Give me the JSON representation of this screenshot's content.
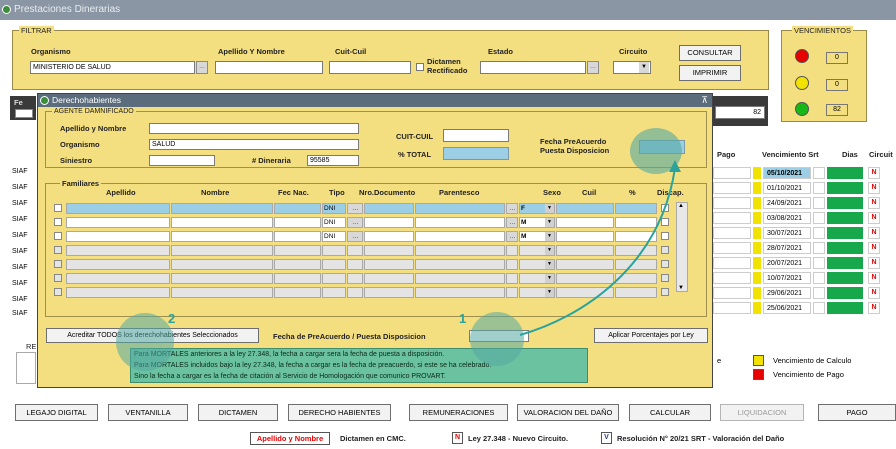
{
  "window": {
    "title": "Prestaciones Dinerarias"
  },
  "filtrar": {
    "group_label": "FILTRAR",
    "organismo_label": "Organismo",
    "organismo_value": "MINISTERIO DE SALUD",
    "apellido_label": "Apellido Y Nombre",
    "cuit_label": "Cuit-Cuil",
    "dictamen_label_1": "Dictamen",
    "dictamen_label_2": "Rectificado",
    "estado_label": "Estado",
    "circuito_label": "Circuito",
    "consultar_button": "CONSULTAR",
    "imprimir_button": "IMPRIMIR"
  },
  "vencimientos": {
    "title": "VENCIMIENTOS",
    "items": [
      {
        "color": "#e60000",
        "count": "0"
      },
      {
        "color": "#f2e200",
        "count": "0"
      },
      {
        "color": "#16b816",
        "count": "82"
      }
    ]
  },
  "background": {
    "total_count": "82",
    "fe_label": "Fe",
    "row_prefix": "SIAF",
    "re_label": "RE",
    "legend_e_fragment": "e",
    "columns": {
      "pago": "Pago",
      "venc_srt": "Vencimiento Srt",
      "dias": "Dias",
      "circuito": "Circuit"
    },
    "rows": [
      {
        "date": "05/10/2021",
        "flag": "N",
        "selected": true
      },
      {
        "date": "01/10/2021",
        "flag": "N",
        "selected": false
      },
      {
        "date": "24/09/2021",
        "flag": "N",
        "selected": false
      },
      {
        "date": "03/08/2021",
        "flag": "N",
        "selected": false
      },
      {
        "date": "30/07/2021",
        "flag": "N",
        "selected": false
      },
      {
        "date": "28/07/2021",
        "flag": "N",
        "selected": false
      },
      {
        "date": "20/07/2021",
        "flag": "N",
        "selected": false
      },
      {
        "date": "10/07/2021",
        "flag": "N",
        "selected": false
      },
      {
        "date": "29/06/2021",
        "flag": "N",
        "selected": false
      },
      {
        "date": "25/06/2021",
        "flag": "N",
        "selected": false
      }
    ],
    "legend": [
      {
        "color": "#f2e200",
        "label": "Vencimiento de Calculo"
      },
      {
        "color": "#e60000",
        "label": "Vencimiento de Pago"
      }
    ]
  },
  "dialog": {
    "title": "Derechohabientes",
    "agente_group": "AGENTE DAMNIFICADO",
    "apellido_label": "Apellido y Nombre",
    "organismo_label": "Organismo",
    "organismo_value": "SALUD",
    "siniestro_label": "Siniestro",
    "dineraria_label": "# Dineraria",
    "dineraria_value": "95585",
    "cuit_label": "CUIT-CUIL",
    "total_label": "% TOTAL",
    "fecha_label_1": "Fecha PreAcuerdo",
    "fecha_label_2": "Puesta Disposicion",
    "familiares_group": "Familiares",
    "columns": [
      "Apellido",
      "Nombre",
      "Fec Nac.",
      "Tipo",
      "Nro.Documento",
      "Parentesco",
      "Sexo",
      "Cuil",
      "%",
      "Discap."
    ],
    "fam_rows": [
      {
        "tipo": "DNI",
        "sexo": "F",
        "active": true
      },
      {
        "tipo": "DNI",
        "sexo": "M",
        "active": true
      },
      {
        "tipo": "DNI",
        "sexo": "M",
        "active": true
      },
      {
        "tipo": "",
        "sexo": "",
        "active": false
      },
      {
        "tipo": "",
        "sexo": "",
        "active": false
      },
      {
        "tipo": "",
        "sexo": "",
        "active": false
      },
      {
        "tipo": "",
        "sexo": "",
        "active": false
      }
    ],
    "acreditar_button": "Acreditar TODOS los derechohabientes Seleccionados",
    "fecha_preacuerdo_label": "Fecha de PreAcuerdo / Puesta Disposicion",
    "aplicar_button": "Aplicar Porcentajes por Ley"
  },
  "tooltip": {
    "line1": "Para MORTALES anteriores a la ley 27.348, la fecha a cargar sera la fecha de puesta a disposición.",
    "line2": "Para MORTALES incluidos bajo la ley 27.348, la fecha a cargar es la fecha de preacuerdo, si este se ha celebrado.",
    "line3": "Sino la fecha a cargar es la fecha de citación al Servicio de Homologación que comunico PROVART."
  },
  "callouts": {
    "one": "1",
    "two": "2"
  },
  "bottom_buttons": [
    "LEGAJO DIGITAL",
    "VENTANILLA",
    "DICTAMEN",
    "DERECHO HABIENTES",
    "REMUNERACIONES",
    "VALORACION DEL DAÑO",
    "CALCULAR",
    "LIQUIDACION",
    "PAGO"
  ],
  "status_legend": {
    "apellido_badge": "Apellido y Nombre",
    "dictamen_text": "Dictamen en CMC.",
    "n_badge": "N",
    "ley_text": "Ley 27.348 - Nuevo Circuito.",
    "v_badge": "V",
    "resolucion_text": "Resolución N° 20/21 SRT - Valoración del Daño"
  },
  "colors": {
    "yellow_panel": "#f4df80",
    "selection_blue": "#9ccfe6",
    "tooltip_green": "#6bc2a0",
    "callout_teal": "#53a8a2"
  }
}
